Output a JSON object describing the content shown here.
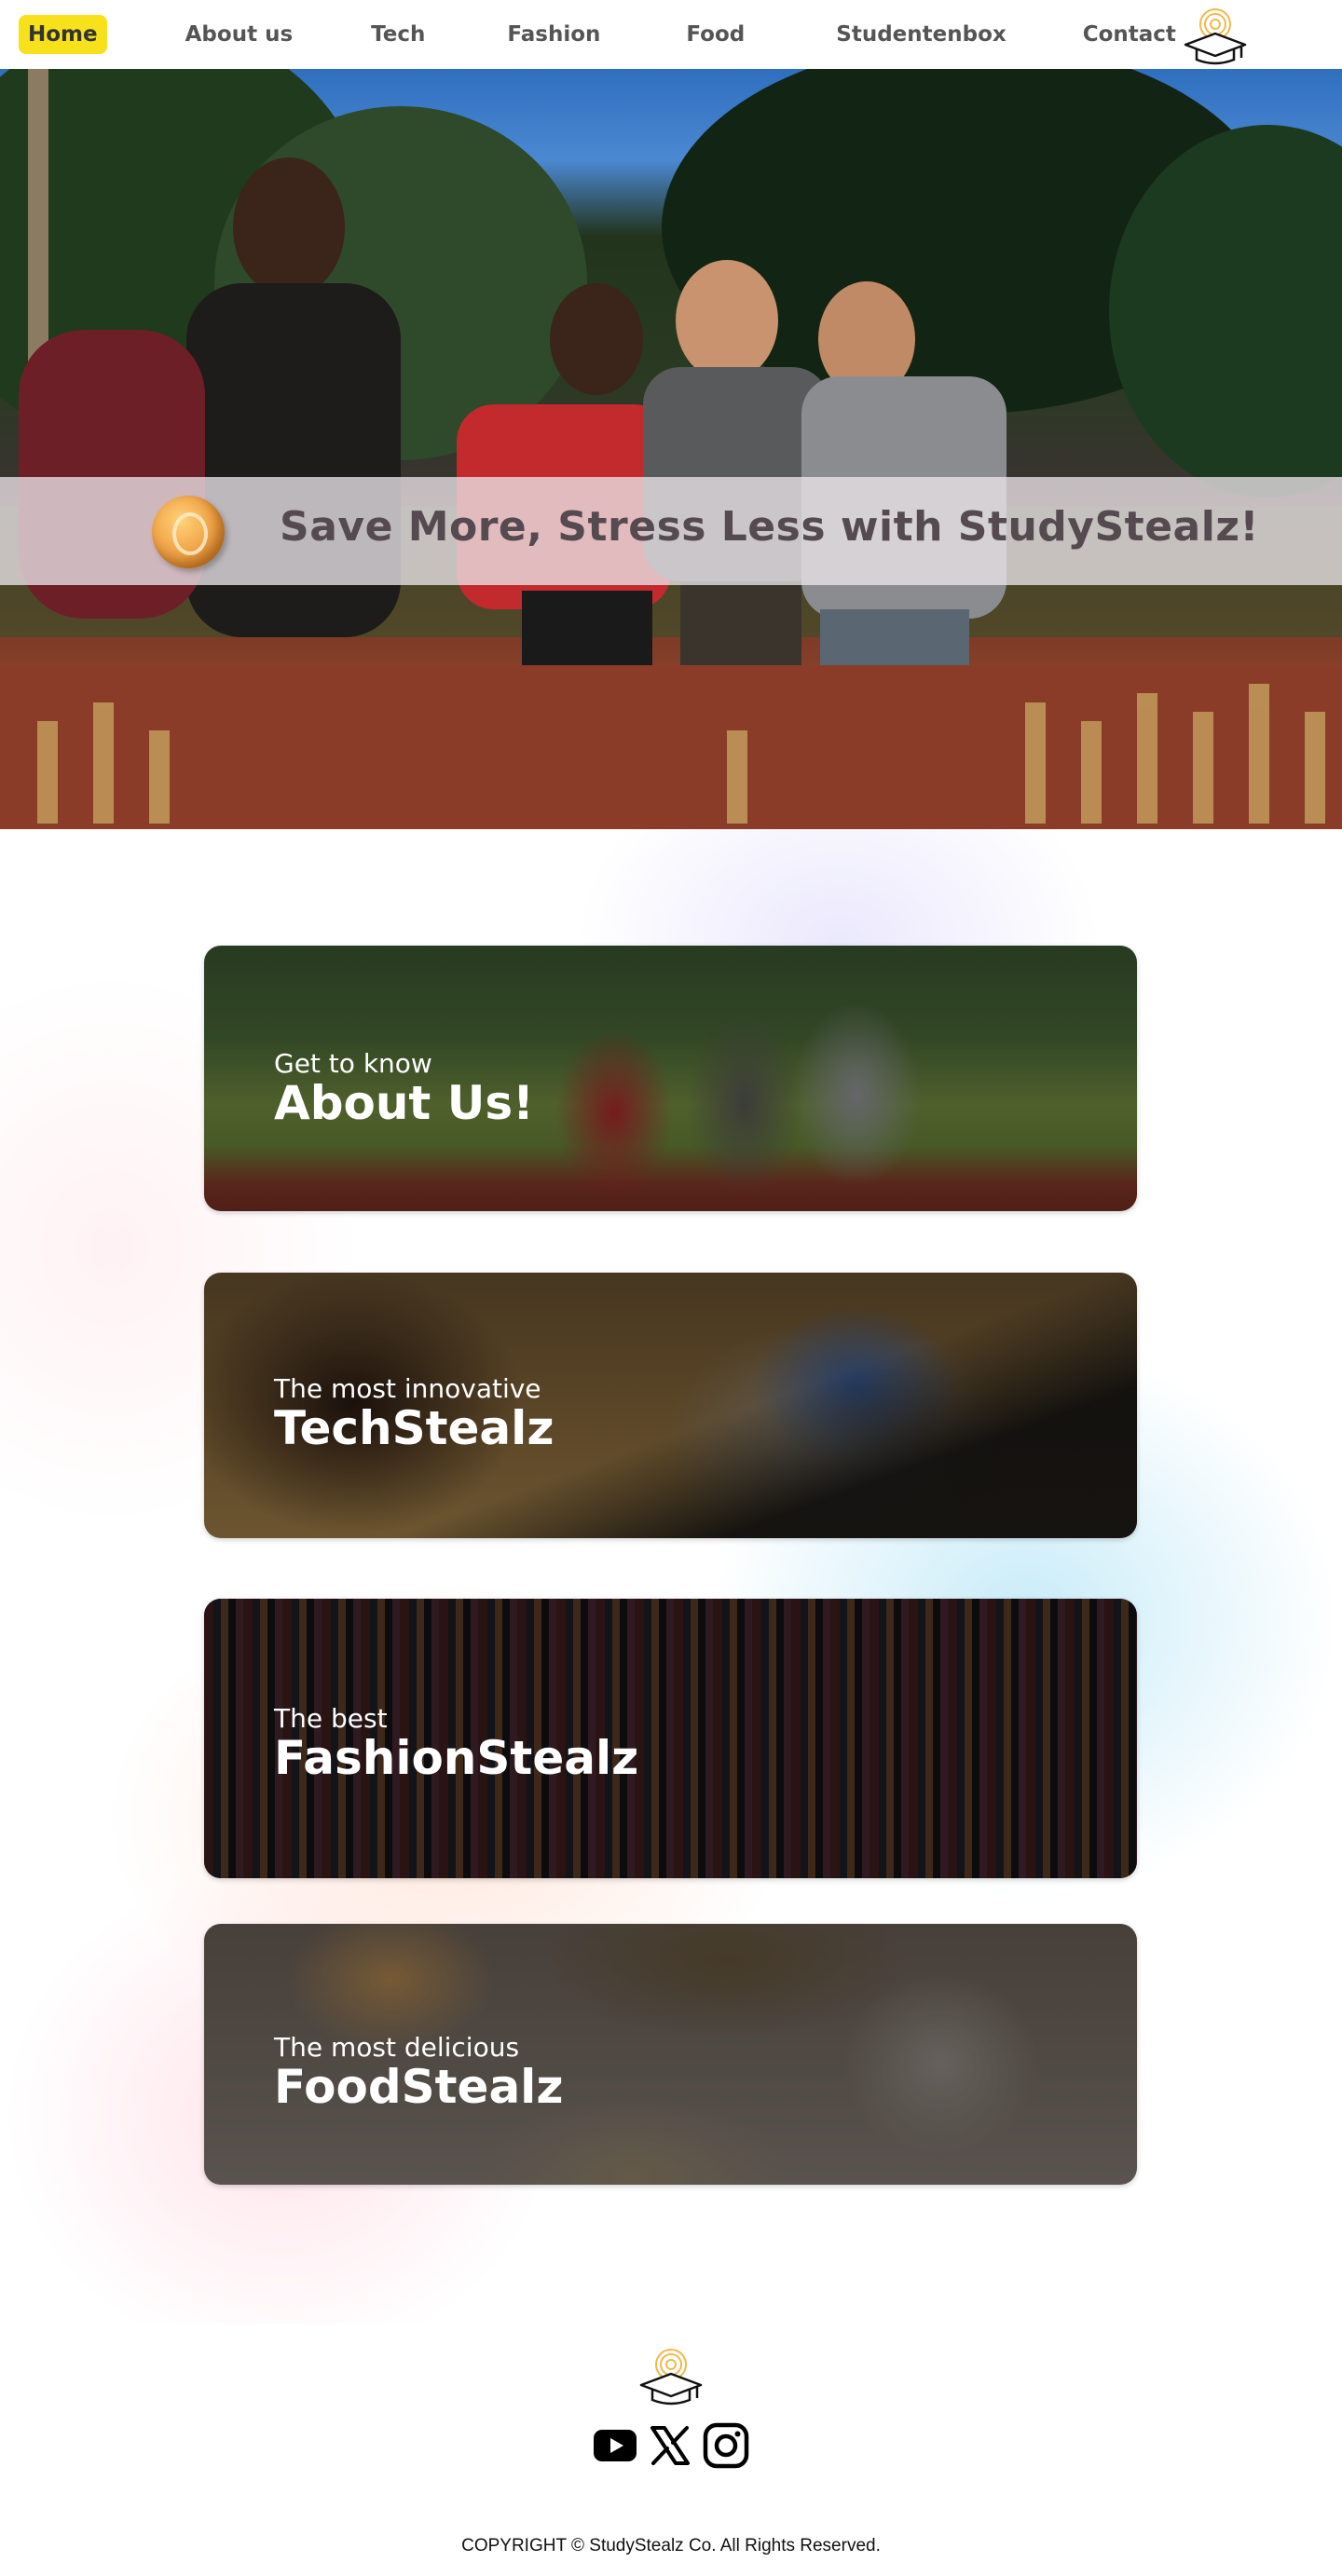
{
  "nav": {
    "items": [
      {
        "label": "Home",
        "active": true
      },
      {
        "label": "About us"
      },
      {
        "label": "Tech"
      },
      {
        "label": "Fashion"
      },
      {
        "label": "Food"
      },
      {
        "label": "Studentenbox"
      },
      {
        "label": "Contact"
      }
    ],
    "logo_icon": "graduation-cap-coin-icon"
  },
  "hero": {
    "banner_text": "Save More, Stress Less with StudyStealz!",
    "coin_icon": "coin-icon"
  },
  "cards": [
    {
      "subtitle": "Get to know",
      "title": "About Us!"
    },
    {
      "subtitle": "The most innovative",
      "title": "TechStealz"
    },
    {
      "subtitle": "The best",
      "title": "FashionStealz"
    },
    {
      "subtitle": "The most delicious",
      "title": "FoodStealz"
    }
  ],
  "footer": {
    "logo_icon": "graduation-cap-coin-icon",
    "social": [
      "youtube-icon",
      "x-icon",
      "instagram-icon"
    ],
    "copyright": "COPYRIGHT © StudyStealz Co. All Rights Reserved."
  },
  "colors": {
    "nav_active": "#f6e11b",
    "banner_text": "#554a50",
    "logo_accent": "#f2b84b"
  }
}
